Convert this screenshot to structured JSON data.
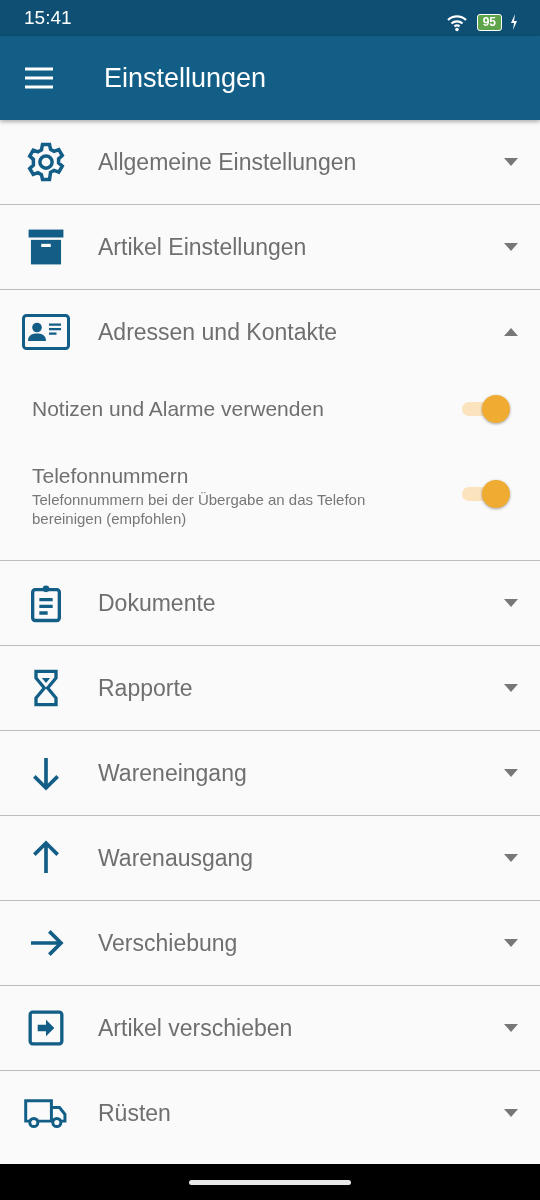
{
  "status_bar": {
    "time": "15:41",
    "battery": "95"
  },
  "app_bar": {
    "title": "Einstellungen"
  },
  "sections": [
    {
      "label": "Allgemeine Einstellungen",
      "expanded": false
    },
    {
      "label": "Artikel Einstellungen",
      "expanded": false
    },
    {
      "label": "Adressen und Kontakte",
      "expanded": true,
      "settings": [
        {
          "title": "Notizen und Alarme verwenden",
          "on": true
        },
        {
          "title": "Telefonnummern",
          "subtitle": "Telefonnummern bei der Übergabe an das Telefon bereinigen (empfohlen)",
          "on": true
        }
      ]
    },
    {
      "label": "Dokumente",
      "expanded": false
    },
    {
      "label": "Rapporte",
      "expanded": false
    },
    {
      "label": "Wareneingang",
      "expanded": false
    },
    {
      "label": "Warenausgang",
      "expanded": false
    },
    {
      "label": "Verschiebung",
      "expanded": false
    },
    {
      "label": "Artikel verschieben",
      "expanded": false
    },
    {
      "label": "Rüsten",
      "expanded": false
    }
  ]
}
